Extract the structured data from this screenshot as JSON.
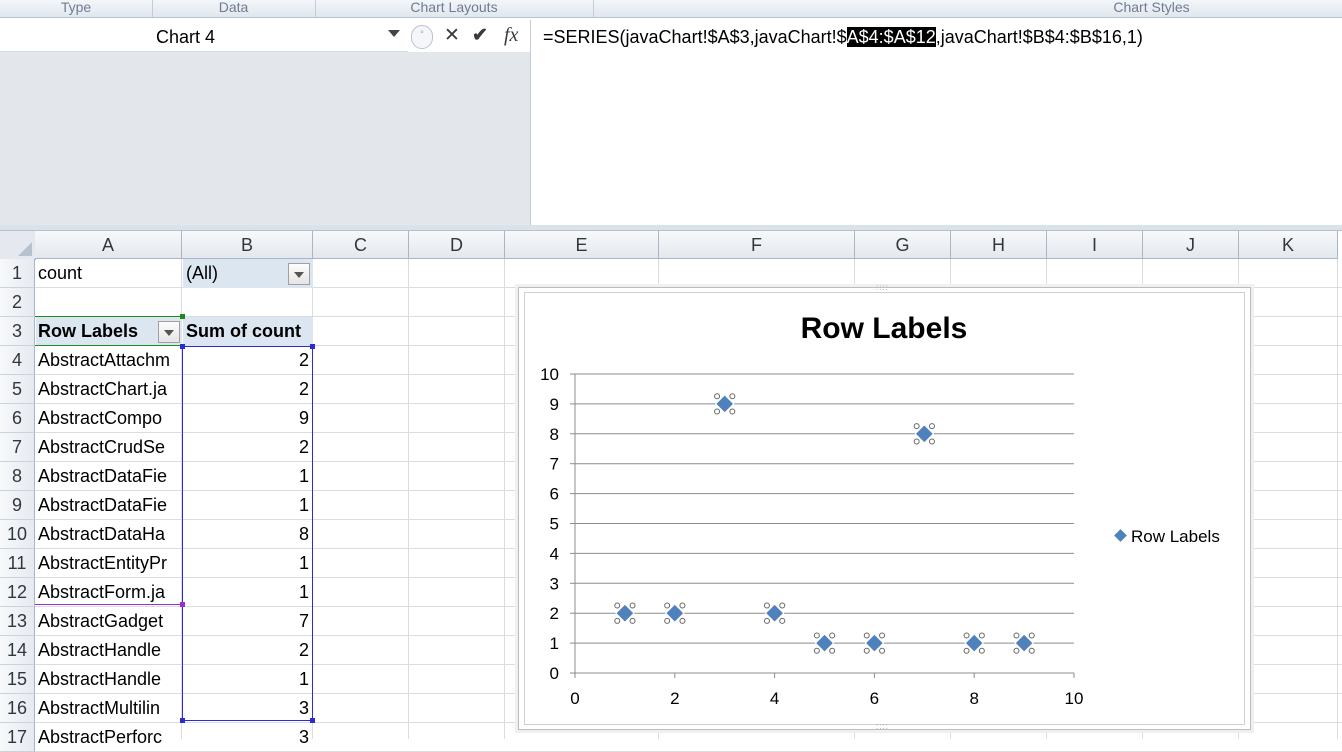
{
  "ribbon": {
    "groups": [
      "Type",
      "Data",
      "Chart Layouts",
      "Chart Styles"
    ]
  },
  "name_box": {
    "value": "Chart 4"
  },
  "formula_bar": {
    "part1": "=SERIES(javaChart!$A$3,javaChart!$",
    "highlight": "A$4:$A$12",
    "part2": ",javaChart!$B$4:$B$16,1)",
    "cancel_icon": "close-icon",
    "enter_icon": "check-icon",
    "fx_icon": "function-icon"
  },
  "sheet": {
    "columns": [
      "A",
      "B",
      "C",
      "D",
      "E",
      "F",
      "G",
      "H",
      "I",
      "J",
      "K"
    ],
    "rows": [
      "1",
      "2",
      "3",
      "4",
      "5",
      "6",
      "7",
      "8",
      "9",
      "10",
      "11",
      "12",
      "13",
      "14",
      "15",
      "16",
      "17"
    ],
    "filter_label": "count",
    "filter_value": "(All)",
    "header_a": "Row Labels",
    "header_b": "Sum of count",
    "labels": [
      "AbstractAttachm",
      "AbstractChart.ja",
      "AbstractCompo",
      "AbstractCrudSe",
      "AbstractDataFie",
      "AbstractDataFie",
      "AbstractDataHa",
      "AbstractEntityPr",
      "AbstractForm.ja",
      "AbstractGadget",
      "AbstractHandle",
      "AbstractHandle",
      "AbstractMultilin",
      "AbstractPerforc"
    ],
    "values": [
      "2",
      "2",
      "9",
      "2",
      "1",
      "1",
      "8",
      "1",
      "1",
      "7",
      "2",
      "1",
      "3",
      "3"
    ]
  },
  "chart_data": {
    "type": "scatter",
    "title": "Row Labels",
    "legend": "Row Labels",
    "legend_position": "right",
    "series_color": "#4f81bd",
    "x": [
      1,
      2,
      3,
      4,
      5,
      6,
      7,
      8,
      9
    ],
    "y": [
      2,
      2,
      9,
      2,
      1,
      1,
      8,
      1,
      1
    ],
    "xlim": [
      0,
      10
    ],
    "ylim": [
      0,
      10
    ],
    "x_ticks": [
      "0",
      "2",
      "4",
      "6",
      "8",
      "10"
    ],
    "y_ticks": [
      "0",
      "1",
      "2",
      "3",
      "4",
      "5",
      "6",
      "7",
      "8",
      "9",
      "10"
    ],
    "grid": "horizontal"
  }
}
